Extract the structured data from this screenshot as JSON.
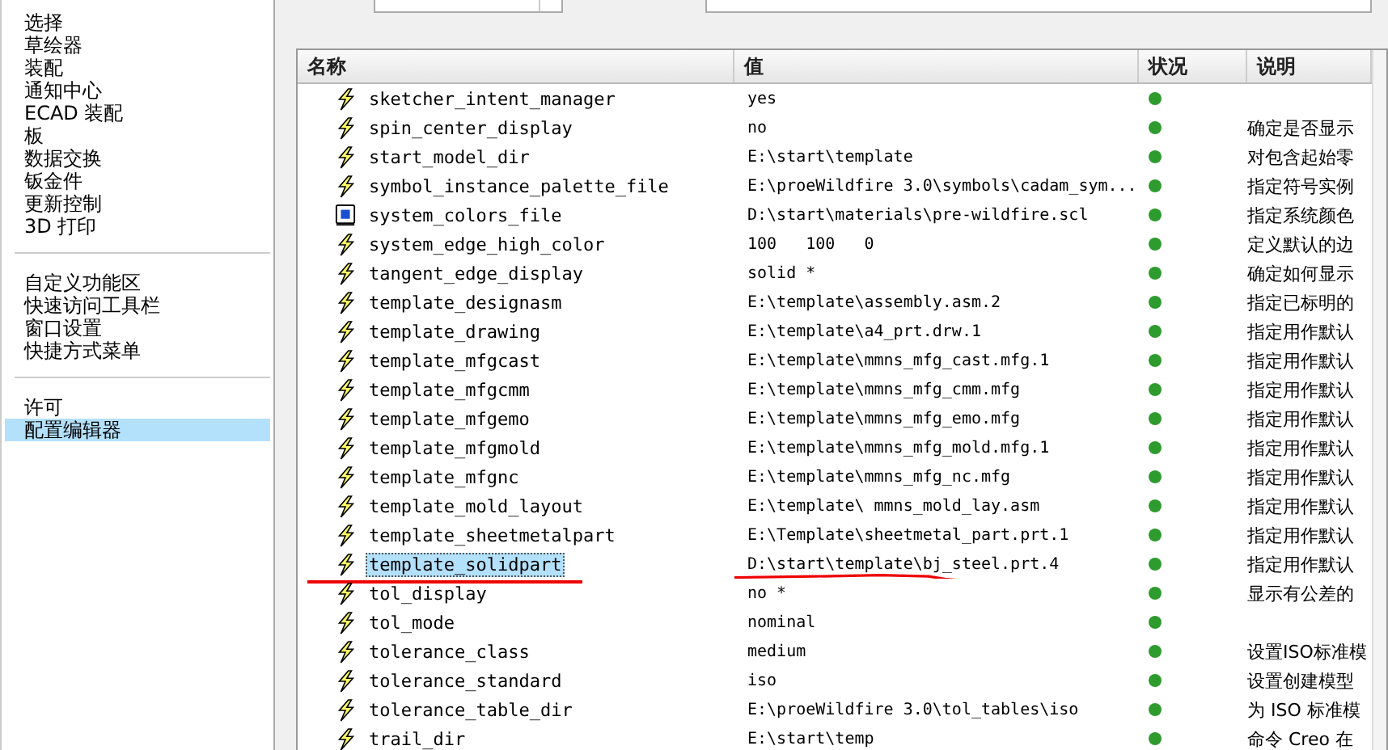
{
  "sidebar": {
    "groups": [
      {
        "items": [
          {
            "label": "选择",
            "selected": false
          },
          {
            "label": "草绘器",
            "selected": false
          },
          {
            "label": "装配",
            "selected": false
          },
          {
            "label": "通知中心",
            "selected": false
          },
          {
            "label": "ECAD 装配",
            "selected": false
          },
          {
            "label": "板",
            "selected": false
          },
          {
            "label": "数据交换",
            "selected": false
          },
          {
            "label": "钣金件",
            "selected": false
          },
          {
            "label": "更新控制",
            "selected": false
          },
          {
            "label": "3D 打印",
            "selected": false
          }
        ]
      },
      {
        "items": [
          {
            "label": "自定义功能区",
            "selected": false
          },
          {
            "label": "快速访问工具栏",
            "selected": false
          },
          {
            "label": "窗口设置",
            "selected": false
          },
          {
            "label": "快捷方式菜单",
            "selected": false
          }
        ]
      },
      {
        "items": [
          {
            "label": "许可",
            "selected": false
          },
          {
            "label": "配置编辑器",
            "selected": true
          }
        ]
      }
    ]
  },
  "table": {
    "columns": [
      "名称",
      "值",
      "状况",
      "说明"
    ],
    "rows": [
      {
        "kind": "option",
        "name": "sketcher_intent_manager",
        "value": "yes",
        "description": "",
        "selected": false,
        "underlined": false
      },
      {
        "kind": "option",
        "name": "spin_center_display",
        "value": "no",
        "description": "确定是否显示",
        "selected": false,
        "underlined": false
      },
      {
        "kind": "option",
        "name": "start_model_dir",
        "value": "E:\\start\\template",
        "description": "对包含起始零",
        "selected": false,
        "underlined": false
      },
      {
        "kind": "option",
        "name": "symbol_instance_palette_file",
        "value": "E:\\proeWildfire 3.0\\symbols\\cadam_sym...",
        "description": "指定符号实例",
        "selected": false,
        "underlined": false
      },
      {
        "kind": "file",
        "name": "system_colors_file",
        "value": "D:\\start\\materials\\pre-wildfire.scl",
        "description": "指定系统颜色",
        "selected": false,
        "underlined": false
      },
      {
        "kind": "option",
        "name": "system_edge_high_color",
        "value": "100   100   0",
        "description": "定义默认的边",
        "selected": false,
        "underlined": false
      },
      {
        "kind": "option",
        "name": "tangent_edge_display",
        "value": "solid *",
        "description": "确定如何显示",
        "selected": false,
        "underlined": false
      },
      {
        "kind": "option",
        "name": "template_designasm",
        "value": "E:\\template\\assembly.asm.2",
        "description": "指定已标明的",
        "selected": false,
        "underlined": false
      },
      {
        "kind": "option",
        "name": "template_drawing",
        "value": "E:\\template\\a4_prt.drw.1",
        "description": "指定用作默认",
        "selected": false,
        "underlined": false
      },
      {
        "kind": "option",
        "name": "template_mfgcast",
        "value": "E:\\template\\mmns_mfg_cast.mfg.1",
        "description": "指定用作默认",
        "selected": false,
        "underlined": false
      },
      {
        "kind": "option",
        "name": "template_mfgcmm",
        "value": "E:\\template\\mmns_mfg_cmm.mfg",
        "description": "指定用作默认",
        "selected": false,
        "underlined": false
      },
      {
        "kind": "option",
        "name": "template_mfgemo",
        "value": "E:\\template\\mmns_mfg_emo.mfg",
        "description": "指定用作默认",
        "selected": false,
        "underlined": false
      },
      {
        "kind": "option",
        "name": "template_mfgmold",
        "value": "E:\\template\\mmns_mfg_mold.mfg.1",
        "description": "指定用作默认",
        "selected": false,
        "underlined": false
      },
      {
        "kind": "option",
        "name": "template_mfgnc",
        "value": "E:\\template\\mmns_mfg_nc.mfg",
        "description": "指定用作默认",
        "selected": false,
        "underlined": false
      },
      {
        "kind": "option",
        "name": "template_mold_layout",
        "value": "E:\\template\\ mmns_mold_lay.asm",
        "description": "指定用作默认",
        "selected": false,
        "underlined": false
      },
      {
        "kind": "option",
        "name": "template_sheetmetalpart",
        "value": "E:\\Template\\sheetmetal_part.prt.1",
        "description": "指定用作默认",
        "selected": false,
        "underlined": false
      },
      {
        "kind": "option",
        "name": "template_solidpart",
        "value": "D:\\start\\template\\bj_steel.prt.4",
        "description": "指定用作默认",
        "selected": true,
        "underlined": true
      },
      {
        "kind": "option",
        "name": "tol_display",
        "value": "no *",
        "description": "显示有公差的",
        "selected": false,
        "underlined": false
      },
      {
        "kind": "option",
        "name": "tol_mode",
        "value": "nominal",
        "description": "",
        "selected": false,
        "underlined": false
      },
      {
        "kind": "option",
        "name": "tolerance_class",
        "value": "medium",
        "description": "设置ISO标准模",
        "selected": false,
        "underlined": false
      },
      {
        "kind": "option",
        "name": "tolerance_standard",
        "value": "iso",
        "description": "设置创建模型",
        "selected": false,
        "underlined": false
      },
      {
        "kind": "option",
        "name": "tolerance_table_dir",
        "value": "E:\\proeWildfire 3.0\\tol_tables\\iso",
        "description": "为 ISO 标准模",
        "selected": false,
        "underlined": false
      },
      {
        "kind": "option",
        "name": "trail_dir",
        "value": "E:\\start\\temp",
        "description": "命令 Creo 在",
        "selected": false,
        "underlined": false
      }
    ]
  }
}
